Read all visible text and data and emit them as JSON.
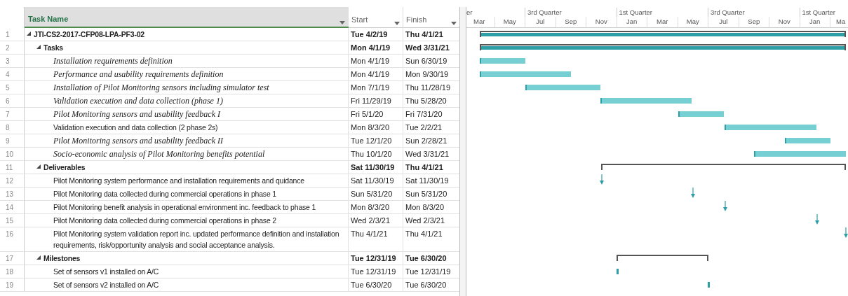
{
  "columns": {
    "name": "Task Name",
    "start": "Start",
    "finish": "Finish"
  },
  "timescale": {
    "quarters": [
      "er",
      "3rd Quarter",
      "1st Quarter",
      "3rd Quarter",
      "1st Quarter"
    ],
    "months": [
      "Mar",
      "May",
      "Jul",
      "Sep",
      "Nov",
      "Jan",
      "Mar",
      "May",
      "Jul",
      "Sep",
      "Nov",
      "Jan",
      "Ma"
    ]
  },
  "rows": [
    {
      "id": "1",
      "name": "JTI-CS2-2017-CFP08-LPA-PF3-02",
      "start": "Tue 4/2/19",
      "finish": "Thu 4/1/21",
      "kind": "summary",
      "expanded": true,
      "rollup": true,
      "children": [
        {
          "id": "2",
          "name": "Tasks",
          "start": "Mon 4/1/19",
          "finish": "Wed 3/31/21",
          "kind": "summary",
          "expanded": true,
          "rollup": true,
          "children": [
            {
              "id": "3",
              "name": "Installation requirements definition",
              "start": "Mon 4/1/19",
              "finish": "Sun 6/30/19",
              "kind": "task",
              "italic": true
            },
            {
              "id": "4",
              "name": "Performance and usability requirements definition",
              "start": "Mon 4/1/19",
              "finish": "Mon 9/30/19",
              "kind": "task",
              "italic": true
            },
            {
              "id": "5",
              "name": "Installation of Pilot Monitoring sensors including simulator test",
              "start": "Mon 7/1/19",
              "finish": "Thu 11/28/19",
              "kind": "task",
              "italic": true
            },
            {
              "id": "6",
              "name": "Validation execution and data collection (phase 1)",
              "start": "Fri 11/29/19",
              "finish": "Thu 5/28/20",
              "kind": "task",
              "italic": true
            },
            {
              "id": "7",
              "name": "Pilot Monitoring sensors and usability feedback I",
              "start": "Fri 5/1/20",
              "finish": "Fri 7/31/20",
              "kind": "task",
              "italic": true
            },
            {
              "id": "8",
              "name": "Validation execution and data collection (2 phase 2s)",
              "start": "Mon 8/3/20",
              "finish": "Tue 2/2/21",
              "kind": "task",
              "italic": false
            },
            {
              "id": "9",
              "name": "Pilot Monitoring sensors and usability feedback II",
              "start": "Tue 12/1/20",
              "finish": "Sun 2/28/21",
              "kind": "task",
              "italic": true
            },
            {
              "id": "10",
              "name": "Socio-economic analysis of Pilot Monitoring benefits potential",
              "start": "Thu 10/1/20",
              "finish": "Wed 3/31/21",
              "kind": "task",
              "italic": true
            }
          ]
        },
        {
          "id": "11",
          "name": "Deliverables",
          "start": "Sat 11/30/19",
          "finish": "Thu 4/1/21",
          "kind": "summary",
          "expanded": true,
          "rollup": false,
          "children": [
            {
              "id": "12",
              "name": "Pilot Monitoring system performance and installation requirements and quidance",
              "start": "Sat 11/30/19",
              "finish": "Sat 11/30/19",
              "kind": "deliverable",
              "italic": false
            },
            {
              "id": "13",
              "name": "Pilot Monitoring data collected during commercial operations in phase 1",
              "start": "Sun 5/31/20",
              "finish": "Sun 5/31/20",
              "kind": "deliverable",
              "italic": false
            },
            {
              "id": "14",
              "name": "Pilot Monitoring benefit analysis in operational environment inc. feedback to phase 1",
              "start": "Mon 8/3/20",
              "finish": "Mon 8/3/20",
              "kind": "deliverable",
              "italic": false
            },
            {
              "id": "15",
              "name": "Pilot Monitoring data collected during commercial operations in phase 2",
              "start": "Wed 2/3/21",
              "finish": "Wed 2/3/21",
              "kind": "deliverable",
              "italic": false
            },
            {
              "id": "16",
              "name": "Pilot Monitoring system validation report inc. updated performance definition and installation requirements, risk/opportunity analysis and social acceptance analysis.",
              "start": "Thu 4/1/21",
              "finish": "Thu 4/1/21",
              "kind": "deliverable",
              "italic": false
            }
          ]
        },
        {
          "id": "17",
          "name": "Milestones",
          "start": "Tue 12/31/19",
          "finish": "Tue 6/30/20",
          "kind": "summary",
          "expanded": true,
          "rollup": false,
          "children": [
            {
              "id": "18",
              "name": "Set of sensors v1 installed on A/C",
              "start": "Tue 12/31/19",
              "finish": "Tue 12/31/19",
              "kind": "milestone",
              "italic": false
            },
            {
              "id": "19",
              "name": "Set of sensors v2 installed on A/C",
              "start": "Tue 6/30/20",
              "finish": "Tue 6/30/20",
              "kind": "milestone",
              "italic": false
            }
          ]
        }
      ]
    }
  ]
}
